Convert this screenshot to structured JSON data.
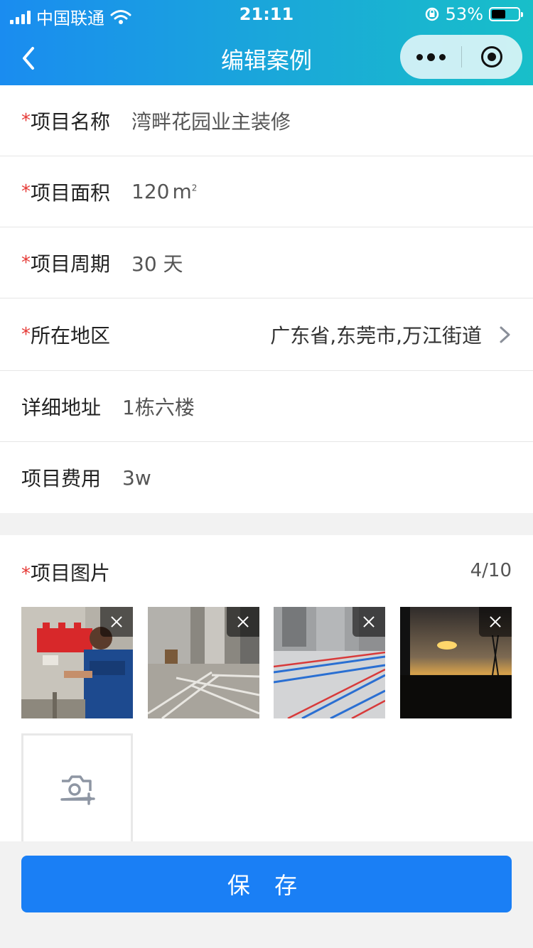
{
  "status_bar": {
    "carrier": "中国联通",
    "time": "21:11",
    "battery_percent": "53%",
    "battery_level": 0.53
  },
  "nav": {
    "title": "编辑案例",
    "back_icon": "chevron-left-icon",
    "more_icon": "more-dots-icon",
    "close_icon": "target-close-icon"
  },
  "form": {
    "required_mark": "*",
    "fields": [
      {
        "label": "项目名称",
        "value": "湾畔花园业主装修",
        "required": true
      },
      {
        "label": "项目面积",
        "value": "120",
        "unit": "m",
        "unit_sup": "2",
        "required": true
      },
      {
        "label": "项目周期",
        "value": "30 天",
        "required": true
      },
      {
        "label": "所在地区",
        "value": "广东省,东莞市,万江街道",
        "required": true
      },
      {
        "label": "详细地址",
        "value": "1栋六楼",
        "required": false
      },
      {
        "label": "项目费用",
        "value": "3w",
        "required": false
      }
    ]
  },
  "photos": {
    "title": "项目图片",
    "required": true,
    "count": "4/10",
    "items": [
      {
        "name": "photo-wall-electrical"
      },
      {
        "name": "photo-floor-pipes"
      },
      {
        "name": "photo-red-blue-lines"
      },
      {
        "name": "photo-sunset"
      }
    ],
    "add_icon": "camera-plus-icon"
  },
  "footer": {
    "save_label": "保 存"
  },
  "colors": {
    "header_start": "#1a8cf0",
    "header_end": "#18bfc9",
    "required": "#e53935",
    "primary": "#1a7ff5"
  }
}
